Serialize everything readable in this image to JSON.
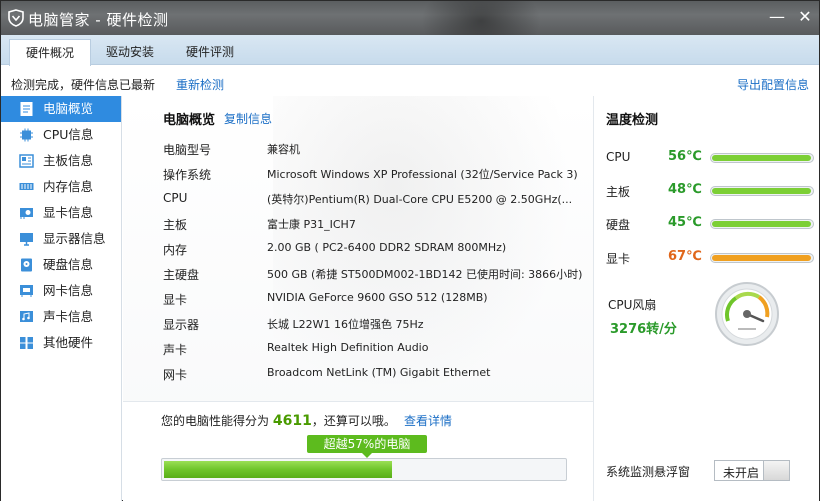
{
  "window": {
    "title": "电脑管家 - 硬件检测",
    "icons": [
      "shield-logo-icon",
      "minimize-icon",
      "close-icon"
    ]
  },
  "tabs": [
    {
      "label": "硬件概况",
      "active": true
    },
    {
      "label": "驱动安装",
      "active": false
    },
    {
      "label": "硬件评测",
      "active": false
    }
  ],
  "status": {
    "text": "检测完成，硬件信息已最新",
    "redetect": "重新检测",
    "export": "导出配置信息"
  },
  "sidebar": {
    "items": [
      {
        "label": "电脑概览",
        "icon": "overview-icon",
        "active": true
      },
      {
        "label": "CPU信息",
        "icon": "cpu-icon"
      },
      {
        "label": "主板信息",
        "icon": "motherboard-icon"
      },
      {
        "label": "内存信息",
        "icon": "memory-icon"
      },
      {
        "label": "显卡信息",
        "icon": "graphics-card-icon"
      },
      {
        "label": "显示器信息",
        "icon": "monitor-icon"
      },
      {
        "label": "硬盘信息",
        "icon": "hard-disk-icon"
      },
      {
        "label": "网卡信息",
        "icon": "network-card-icon"
      },
      {
        "label": "声卡信息",
        "icon": "sound-card-icon"
      },
      {
        "label": "其他硬件",
        "icon": "other-hardware-icon"
      }
    ]
  },
  "overview": {
    "title": "电脑概览",
    "copy": "复制信息",
    "rows": [
      {
        "key": "电脑型号",
        "value": "兼容机"
      },
      {
        "key": "操作系统",
        "value": "Microsoft Windows XP Professional (32位/Service Pack 3)"
      },
      {
        "key": "CPU",
        "value": "(英特尔)Pentium(R) Dual-Core  CPU      E5200  @ 2.50GHz(..."
      },
      {
        "key": "主板",
        "value": "富士康 P31_ICH7"
      },
      {
        "key": "内存",
        "value": "2.00 GB ( PC2-6400 DDR2 SDRAM 800MHz)"
      },
      {
        "key": "主硬盘",
        "value": "500 GB (希捷 ST500DM002-1BD142 已使用时间: 3866小时)"
      },
      {
        "key": "显卡",
        "value": "NVIDIA GeForce 9600 GSO 512 (128MB)"
      },
      {
        "key": "显示器",
        "value": "长城 L22W1 16位增强色 75Hz"
      },
      {
        "key": "声卡",
        "value": "Realtek High Definition Audio"
      },
      {
        "key": "网卡",
        "value": "Broadcom NetLink (TM) Gigabit Ethernet"
      }
    ]
  },
  "performance": {
    "prefix": "您的电脑性能得分为",
    "score": "4611",
    "suffix": "，还算可以哦。",
    "detail": "查看详情",
    "beat": "超越57%的电脑",
    "beat_fraction": 0.57
  },
  "temperature": {
    "title": "温度检测",
    "items": [
      {
        "label": "CPU",
        "value": "56℃",
        "color": "#2a9a2a",
        "fill_color": "#7ccf35",
        "level": 0.99
      },
      {
        "label": "主板",
        "value": "48℃",
        "color": "#2a9a2a",
        "fill_color": "#7ccf35",
        "level": 0.99
      },
      {
        "label": "硬盘",
        "value": "45℃",
        "color": "#2a9a2a",
        "fill_color": "#7ccf35",
        "level": 0.99
      },
      {
        "label": "显卡",
        "value": "67℃",
        "color": "#e0661a",
        "fill_color": "#f0a020",
        "level": 0.99
      }
    ],
    "fan_label": "CPU风扇",
    "fan_value": "3276转/分",
    "float_label": "系统监测悬浮窗",
    "float_toggle": "未开启"
  }
}
